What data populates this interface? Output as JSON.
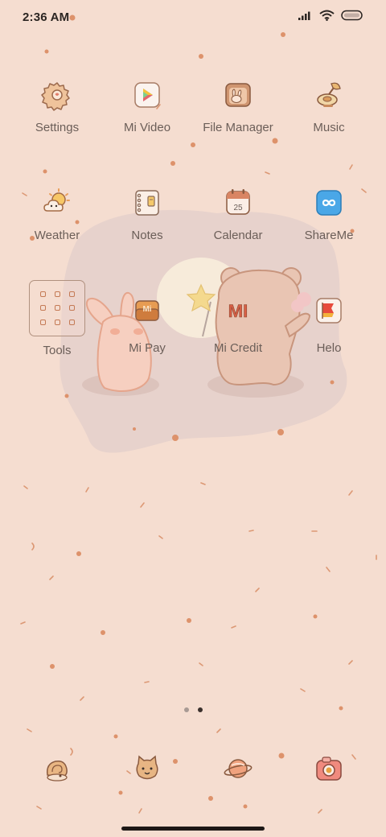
{
  "status_bar": {
    "time": "2:36 AM",
    "icons": [
      "signal-icon",
      "wifi-icon",
      "battery-icon"
    ]
  },
  "home": {
    "apps": [
      {
        "label": "Settings",
        "icon": "gear-icon"
      },
      {
        "label": "Mi Video",
        "icon": "play-icon"
      },
      {
        "label": "File Manager",
        "icon": "folder-bunny-icon"
      },
      {
        "label": "Music",
        "icon": "gramophone-icon"
      },
      {
        "label": "Weather",
        "icon": "sun-cloud-icon"
      },
      {
        "label": "Notes",
        "icon": "notebook-icon"
      },
      {
        "label": "Calendar",
        "icon": "calendar-icon",
        "date_text": "25"
      },
      {
        "label": "ShareMe",
        "icon": "infinity-icon"
      },
      {
        "label": "Tools",
        "icon": "folder-grid-icon"
      },
      {
        "label": "Mi Pay",
        "icon": "wallet-icon",
        "icon_text": "Mi"
      },
      {
        "label": "Mi Credit",
        "icon": "mi-logo-icon",
        "icon_text": "MI"
      },
      {
        "label": "Helo",
        "icon": "flag-icon"
      }
    ]
  },
  "pager": {
    "pages": 2,
    "current": 2
  },
  "dock": [
    {
      "icon": "snail-shell-icon"
    },
    {
      "icon": "cat-face-icon"
    },
    {
      "icon": "planet-icon"
    },
    {
      "icon": "camera-icon"
    }
  ],
  "colors": {
    "background": "#f5ddd0",
    "accent": "#d9865f",
    "text": "#6b5e58",
    "status_text": "#2b2522"
  }
}
